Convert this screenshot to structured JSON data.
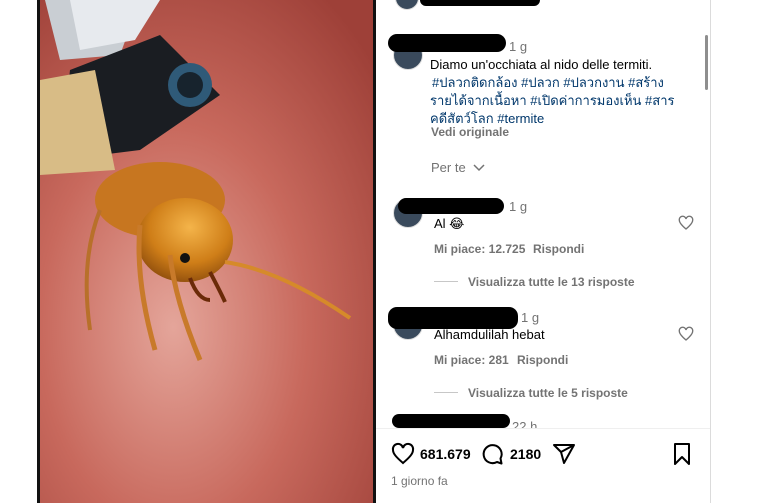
{
  "post": {
    "author_time": "1 g",
    "caption_text": "Diamo un'occhiata al nido delle termiti.",
    "hashtags_line1": "#ปลวกติดกล้อง #ปลวก #ปลวกงาน #สร้าง",
    "hashtags_line2": "รายได้จากเนื้อหา #เปิดค่าการมองเห็น #สาร",
    "hashtags_line3": "คดีสัตว์โลก #termite",
    "see_original": "Vedi originale",
    "sort_label": "Per te"
  },
  "comments": [
    {
      "time": "1 g",
      "text": "Al 😂",
      "likes": "Mi piace: 12.725",
      "reply": "Rispondi",
      "view_replies": "Visualizza tutte le 13 risposte"
    },
    {
      "time": "1 g",
      "text": "Alhamdulilah hebat",
      "likes": "Mi piace: 281",
      "reply": "Rispondi",
      "view_replies": "Visualizza tutte le 5 risposte"
    },
    {
      "time": "22 h"
    }
  ],
  "actions": {
    "likes_count": "681.679",
    "comments_count": "2180",
    "icons": [
      "heart-icon",
      "comment-icon",
      "share-icon",
      "bookmark-icon"
    ]
  },
  "footer": {
    "date": "1 giorno fa"
  },
  "colors": {
    "hashtag": "#00376b",
    "muted": "#737373"
  }
}
